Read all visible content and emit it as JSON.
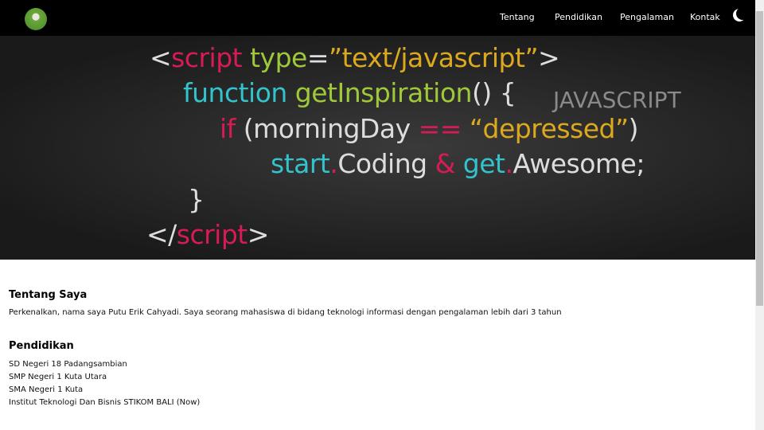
{
  "nav": {
    "items": [
      "Tentang",
      "Pendidikan",
      "Pengalaman",
      "Kontak"
    ]
  },
  "hero": {
    "l1": [
      "<",
      "script",
      " type",
      "=",
      "”text/javascript”",
      ">"
    ],
    "l2": [
      "function",
      " getInspiration",
      "() {"
    ],
    "l3": [
      "if",
      " (morningDay ",
      "==",
      " “depressed”",
      ")"
    ],
    "l4": [
      "start",
      ".",
      "Coding ",
      "&",
      " get",
      ".",
      "Awesome;"
    ],
    "l5": "}",
    "l6": [
      "</",
      "script",
      ">"
    ],
    "label": "JAVASCRIPT"
  },
  "about": {
    "title": "Tentang Saya",
    "text": "Perkenalkan, nama saya Putu Erik Cahyadi. Saya seorang mahasiswa di bidang teknologi informasi dengan pengalaman lebih dari 3 tahun"
  },
  "education": {
    "title": "Pendidikan",
    "items": [
      "SD Negeri 18 Padangsambian",
      "SMP Negeri 1 Kuta Utara",
      "SMA Negeri 1 Kuta",
      "Institut Teknologi Dan Bisnis STIKOM BALI (Now)"
    ]
  }
}
